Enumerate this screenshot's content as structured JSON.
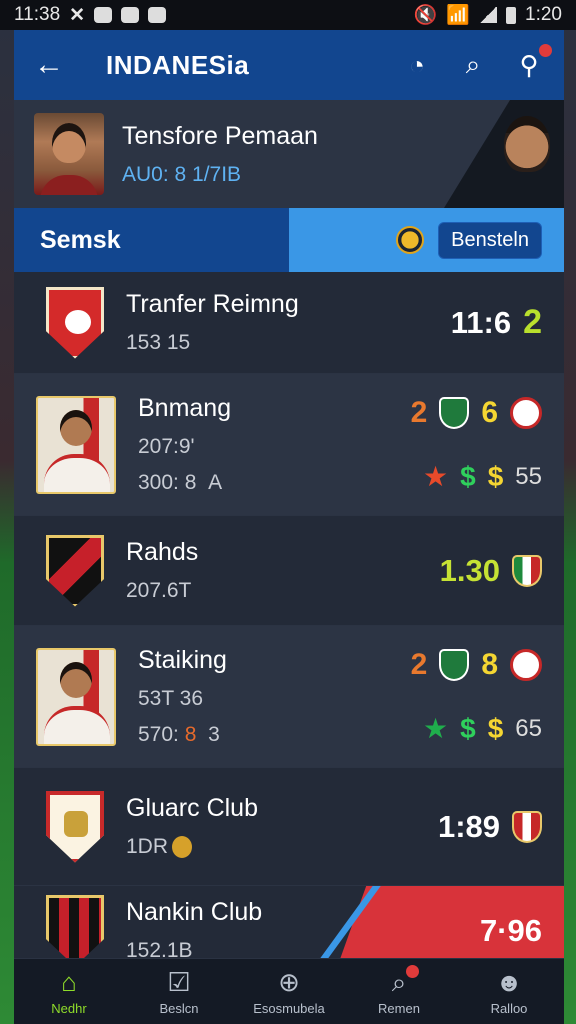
{
  "status_bar": {
    "time_left": "11:38",
    "time_right": "1:20"
  },
  "app_bar": {
    "title": "INDANESia",
    "icons": [
      "back-arrow-icon",
      "ball-icon",
      "search-icon",
      "profile-icon"
    ]
  },
  "feature": {
    "title": "Tensfore Pemaan",
    "subtitle": "AU0: 8 1/7IB"
  },
  "section": {
    "title": "Semsk",
    "button_label": "Bensteln"
  },
  "rows": [
    {
      "name": "Tranfer Reimng",
      "meta": "153 15",
      "score": "11:6",
      "score_extra": "2"
    },
    {
      "name": "Bnmang",
      "meta": "207:9'",
      "meta2_a": "300: 8",
      "meta2_b": "A",
      "num1": "2",
      "num2": "6",
      "count": "55"
    },
    {
      "name": "Rahds",
      "meta": "207.6T",
      "score": "1.30"
    },
    {
      "name": "Staiking",
      "meta": "53T 36",
      "meta2_a": "570:",
      "meta2_hl": "8",
      "meta2_b": "3",
      "num1": "2",
      "num2": "8",
      "count": "65"
    },
    {
      "name": "Gluarc Club",
      "meta": "1DR",
      "score": "1:89"
    },
    {
      "name": "Nankin Club",
      "meta": "152.1B",
      "score": "7·96"
    }
  ],
  "bottom_nav": [
    {
      "label": "Nedhr",
      "icon": "home-icon",
      "active": true
    },
    {
      "label": "Beslcn",
      "icon": "checkbox-icon",
      "active": false
    },
    {
      "label": "Esosmubela",
      "icon": "add-circle-icon",
      "active": false
    },
    {
      "label": "Remen",
      "icon": "search-icon",
      "active": false
    },
    {
      "label": "Ralloo",
      "icon": "person-icon",
      "active": false
    }
  ],
  "colors": {
    "app_bar": "#12468f",
    "accent_blue": "#3a97e6",
    "accent_lime": "#c6e234",
    "accent_red": "#d8333a"
  }
}
